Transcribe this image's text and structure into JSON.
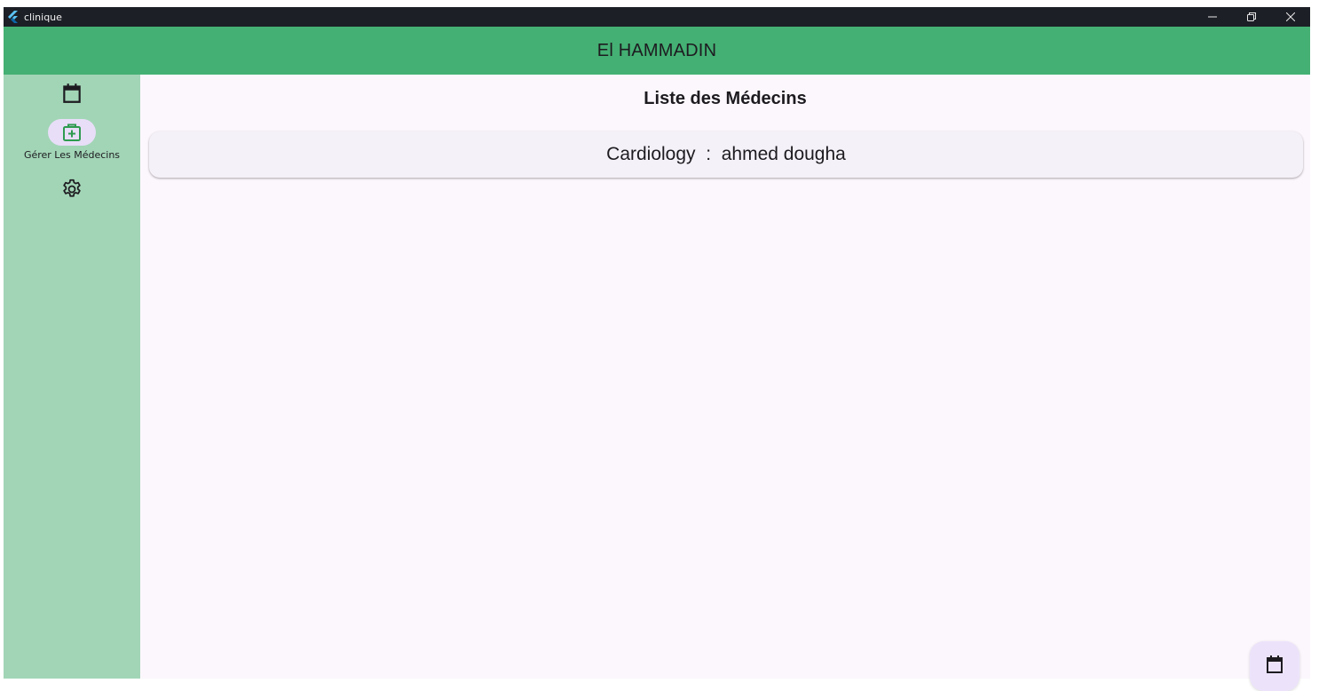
{
  "window": {
    "title": "clinique",
    "icons": {
      "app": "flutter-logo-icon",
      "minimize": "minimize-icon",
      "restore": "restore-icon",
      "close": "close-icon"
    }
  },
  "appbar": {
    "title": "El HAMMADIN",
    "color": "#44b073"
  },
  "rail": {
    "color": "#a2d5b6",
    "items": [
      {
        "icon": "calendar-icon",
        "label": "",
        "selected": false
      },
      {
        "icon": "medical-bag-icon",
        "label": "Gérer Les Médecins",
        "selected": true
      },
      {
        "icon": "settings-gear-icon",
        "label": "",
        "selected": false
      }
    ]
  },
  "main": {
    "title": "Liste des Médecins",
    "doctors": [
      {
        "text": "Cardiology  :  ahmed dougha"
      }
    ]
  },
  "fab": {
    "icon": "calendar-icon"
  }
}
